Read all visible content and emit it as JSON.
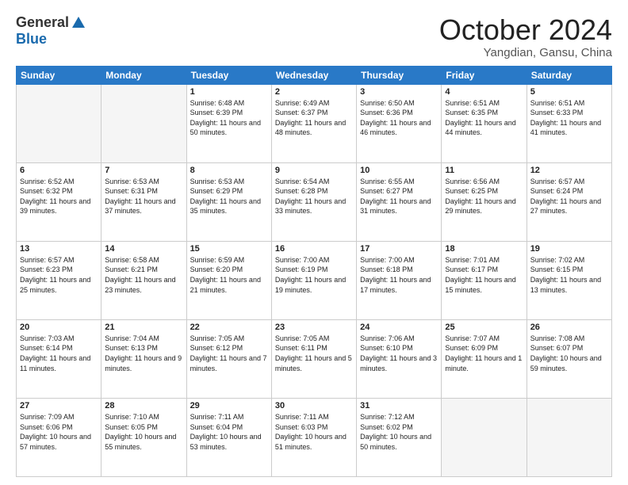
{
  "header": {
    "logo_general": "General",
    "logo_blue": "Blue",
    "month": "October 2024",
    "location": "Yangdian, Gansu, China"
  },
  "days_of_week": [
    "Sunday",
    "Monday",
    "Tuesday",
    "Wednesday",
    "Thursday",
    "Friday",
    "Saturday"
  ],
  "weeks": [
    [
      {
        "day": "",
        "info": ""
      },
      {
        "day": "",
        "info": ""
      },
      {
        "day": "1",
        "info": "Sunrise: 6:48 AM\nSunset: 6:39 PM\nDaylight: 11 hours and 50 minutes."
      },
      {
        "day": "2",
        "info": "Sunrise: 6:49 AM\nSunset: 6:37 PM\nDaylight: 11 hours and 48 minutes."
      },
      {
        "day": "3",
        "info": "Sunrise: 6:50 AM\nSunset: 6:36 PM\nDaylight: 11 hours and 46 minutes."
      },
      {
        "day": "4",
        "info": "Sunrise: 6:51 AM\nSunset: 6:35 PM\nDaylight: 11 hours and 44 minutes."
      },
      {
        "day": "5",
        "info": "Sunrise: 6:51 AM\nSunset: 6:33 PM\nDaylight: 11 hours and 41 minutes."
      }
    ],
    [
      {
        "day": "6",
        "info": "Sunrise: 6:52 AM\nSunset: 6:32 PM\nDaylight: 11 hours and 39 minutes."
      },
      {
        "day": "7",
        "info": "Sunrise: 6:53 AM\nSunset: 6:31 PM\nDaylight: 11 hours and 37 minutes."
      },
      {
        "day": "8",
        "info": "Sunrise: 6:53 AM\nSunset: 6:29 PM\nDaylight: 11 hours and 35 minutes."
      },
      {
        "day": "9",
        "info": "Sunrise: 6:54 AM\nSunset: 6:28 PM\nDaylight: 11 hours and 33 minutes."
      },
      {
        "day": "10",
        "info": "Sunrise: 6:55 AM\nSunset: 6:27 PM\nDaylight: 11 hours and 31 minutes."
      },
      {
        "day": "11",
        "info": "Sunrise: 6:56 AM\nSunset: 6:25 PM\nDaylight: 11 hours and 29 minutes."
      },
      {
        "day": "12",
        "info": "Sunrise: 6:57 AM\nSunset: 6:24 PM\nDaylight: 11 hours and 27 minutes."
      }
    ],
    [
      {
        "day": "13",
        "info": "Sunrise: 6:57 AM\nSunset: 6:23 PM\nDaylight: 11 hours and 25 minutes."
      },
      {
        "day": "14",
        "info": "Sunrise: 6:58 AM\nSunset: 6:21 PM\nDaylight: 11 hours and 23 minutes."
      },
      {
        "day": "15",
        "info": "Sunrise: 6:59 AM\nSunset: 6:20 PM\nDaylight: 11 hours and 21 minutes."
      },
      {
        "day": "16",
        "info": "Sunrise: 7:00 AM\nSunset: 6:19 PM\nDaylight: 11 hours and 19 minutes."
      },
      {
        "day": "17",
        "info": "Sunrise: 7:00 AM\nSunset: 6:18 PM\nDaylight: 11 hours and 17 minutes."
      },
      {
        "day": "18",
        "info": "Sunrise: 7:01 AM\nSunset: 6:17 PM\nDaylight: 11 hours and 15 minutes."
      },
      {
        "day": "19",
        "info": "Sunrise: 7:02 AM\nSunset: 6:15 PM\nDaylight: 11 hours and 13 minutes."
      }
    ],
    [
      {
        "day": "20",
        "info": "Sunrise: 7:03 AM\nSunset: 6:14 PM\nDaylight: 11 hours and 11 minutes."
      },
      {
        "day": "21",
        "info": "Sunrise: 7:04 AM\nSunset: 6:13 PM\nDaylight: 11 hours and 9 minutes."
      },
      {
        "day": "22",
        "info": "Sunrise: 7:05 AM\nSunset: 6:12 PM\nDaylight: 11 hours and 7 minutes."
      },
      {
        "day": "23",
        "info": "Sunrise: 7:05 AM\nSunset: 6:11 PM\nDaylight: 11 hours and 5 minutes."
      },
      {
        "day": "24",
        "info": "Sunrise: 7:06 AM\nSunset: 6:10 PM\nDaylight: 11 hours and 3 minutes."
      },
      {
        "day": "25",
        "info": "Sunrise: 7:07 AM\nSunset: 6:09 PM\nDaylight: 11 hours and 1 minute."
      },
      {
        "day": "26",
        "info": "Sunrise: 7:08 AM\nSunset: 6:07 PM\nDaylight: 10 hours and 59 minutes."
      }
    ],
    [
      {
        "day": "27",
        "info": "Sunrise: 7:09 AM\nSunset: 6:06 PM\nDaylight: 10 hours and 57 minutes."
      },
      {
        "day": "28",
        "info": "Sunrise: 7:10 AM\nSunset: 6:05 PM\nDaylight: 10 hours and 55 minutes."
      },
      {
        "day": "29",
        "info": "Sunrise: 7:11 AM\nSunset: 6:04 PM\nDaylight: 10 hours and 53 minutes."
      },
      {
        "day": "30",
        "info": "Sunrise: 7:11 AM\nSunset: 6:03 PM\nDaylight: 10 hours and 51 minutes."
      },
      {
        "day": "31",
        "info": "Sunrise: 7:12 AM\nSunset: 6:02 PM\nDaylight: 10 hours and 50 minutes."
      },
      {
        "day": "",
        "info": ""
      },
      {
        "day": "",
        "info": ""
      }
    ]
  ]
}
